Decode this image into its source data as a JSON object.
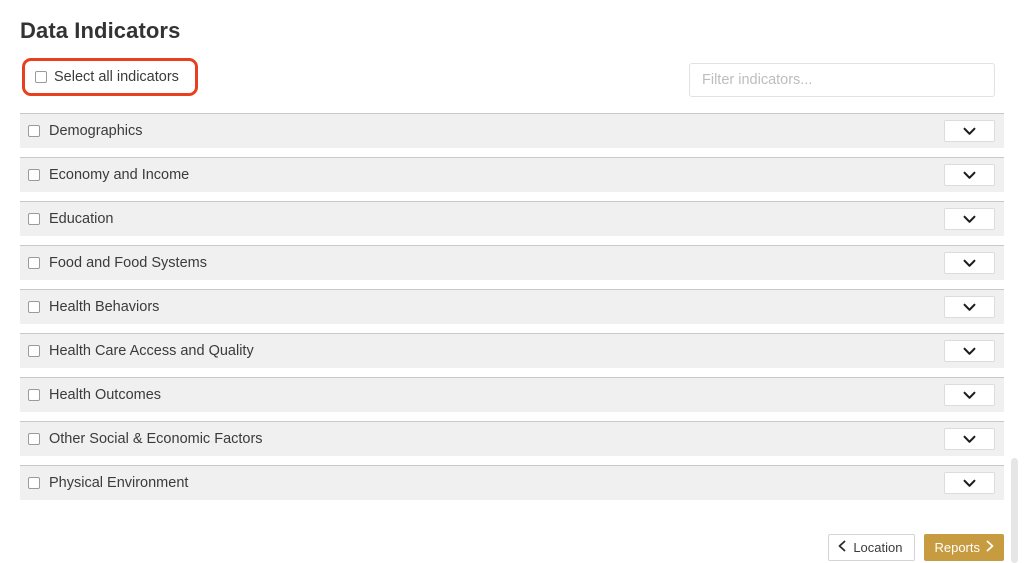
{
  "page": {
    "title": "Data Indicators"
  },
  "select_all": {
    "label": "Select all indicators",
    "checked": false,
    "highlight_color": "#e8401f"
  },
  "filter": {
    "placeholder": "Filter indicators...",
    "value": ""
  },
  "indicators": [
    {
      "label": "Demographics",
      "checked": false,
      "expanded": false
    },
    {
      "label": "Economy and Income",
      "checked": false,
      "expanded": false
    },
    {
      "label": "Education",
      "checked": false,
      "expanded": false
    },
    {
      "label": "Food and Food Systems",
      "checked": false,
      "expanded": false
    },
    {
      "label": "Health Behaviors",
      "checked": false,
      "expanded": false
    },
    {
      "label": "Health Care Access and Quality",
      "checked": false,
      "expanded": false
    },
    {
      "label": "Health Outcomes",
      "checked": false,
      "expanded": false
    },
    {
      "label": "Other Social & Economic Factors",
      "checked": false,
      "expanded": false
    },
    {
      "label": "Physical Environment",
      "checked": false,
      "expanded": false
    }
  ],
  "footer": {
    "back_label": "Location",
    "next_label": "Reports",
    "next_color": "#c79b40"
  },
  "icons": {
    "row_expand": "chevron-down-icon",
    "back": "chevron-left-icon",
    "next": "chevron-right-icon"
  }
}
